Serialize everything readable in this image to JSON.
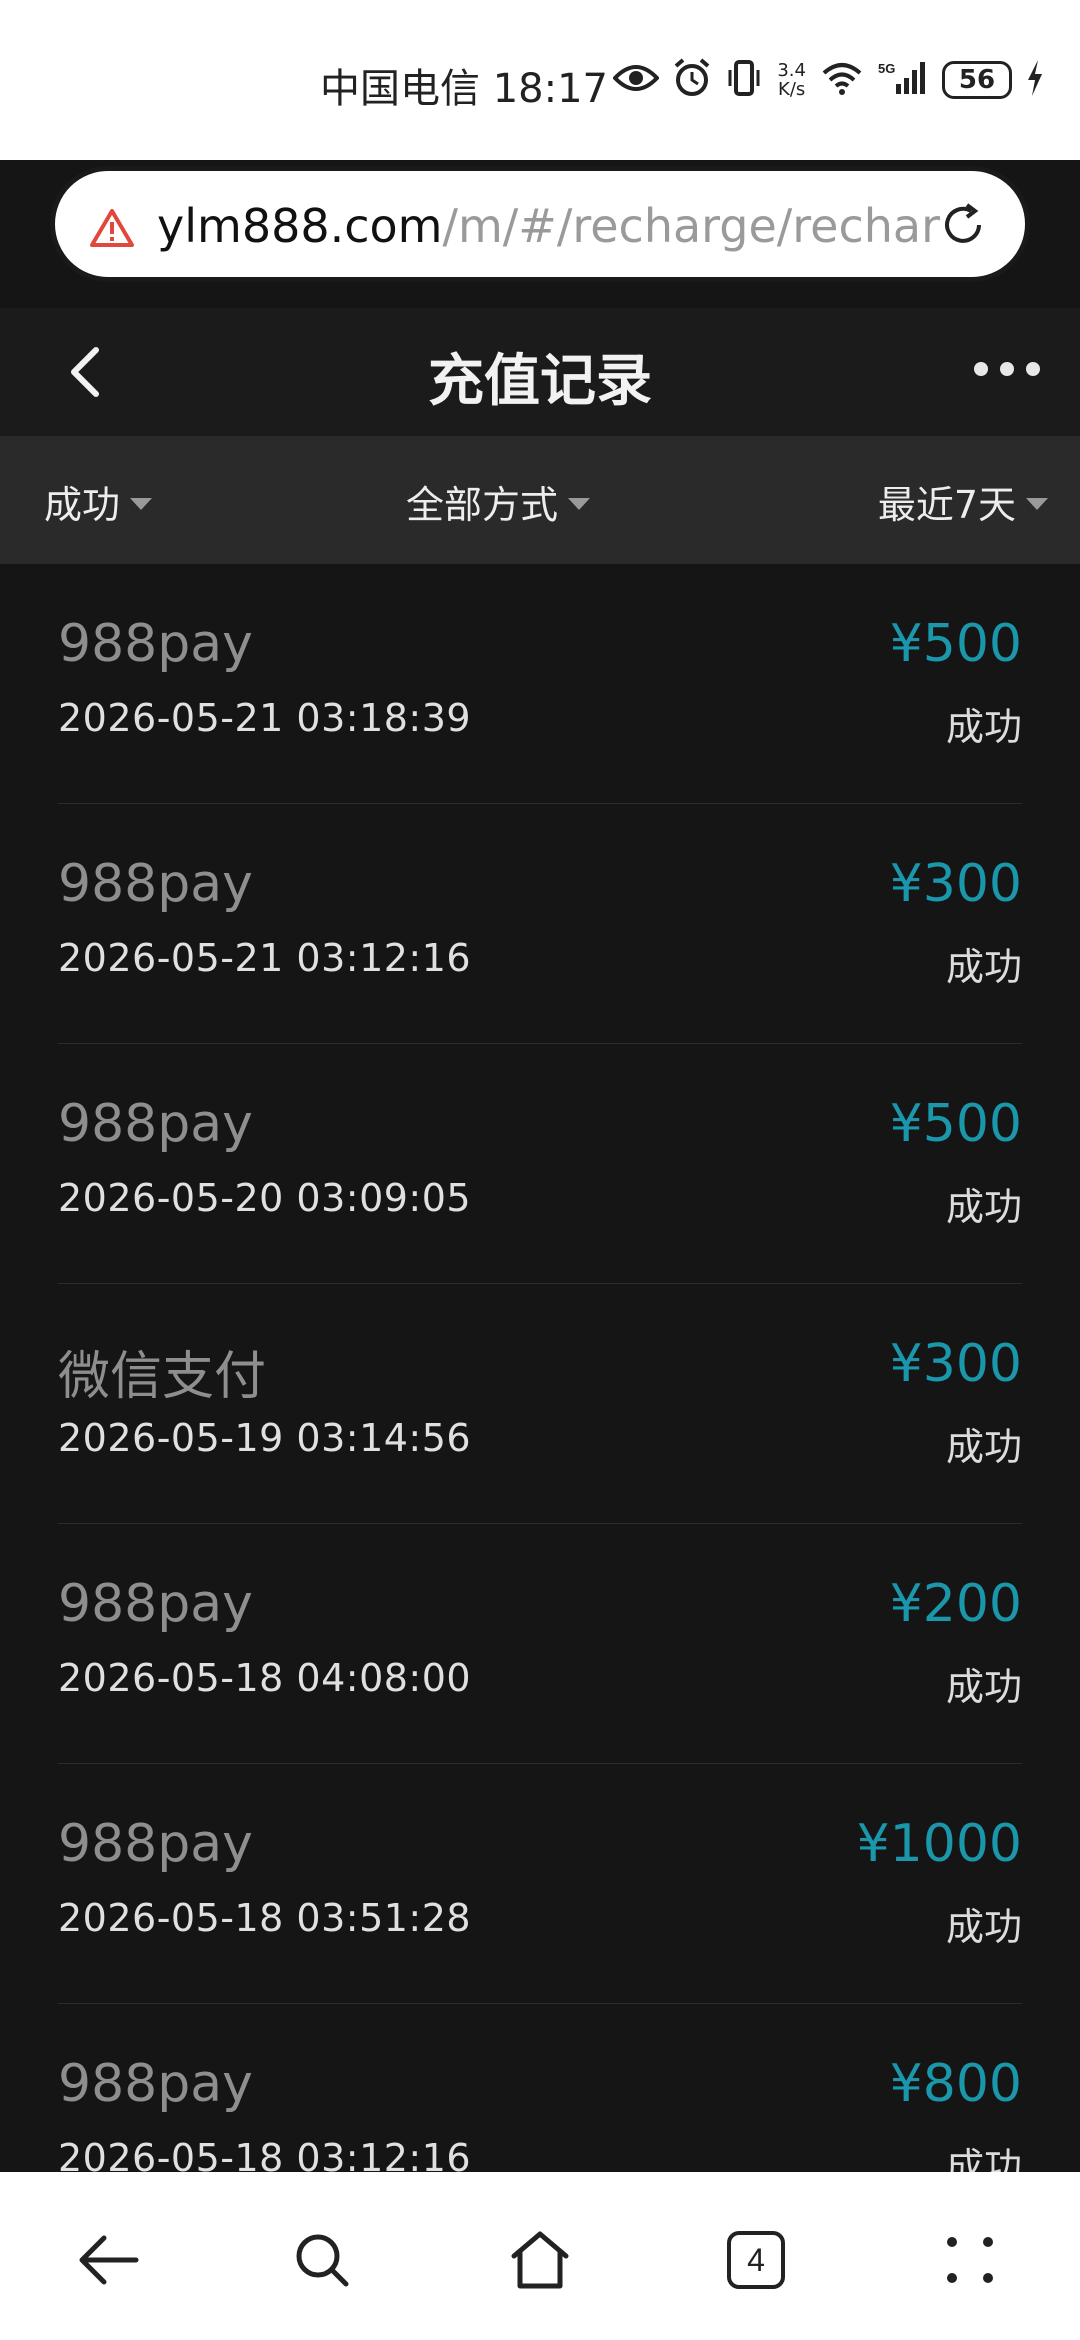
{
  "status_bar": {
    "carrier_time": "中国电信 18:17",
    "speed_value": "3.4",
    "speed_unit": "K/s",
    "network": "5G",
    "battery": "56"
  },
  "url_bar": {
    "host": "ylm888.com",
    "path": "/m/#/recharge/rechar"
  },
  "header": {
    "title": "充值记录"
  },
  "filters": {
    "status": "成功",
    "method": "全部方式",
    "time": "最近7天"
  },
  "records": [
    {
      "method": "988pay",
      "time": "2026-05-21 03:18:39",
      "amount": "¥500",
      "status": "成功"
    },
    {
      "method": "988pay",
      "time": "2026-05-21 03:12:16",
      "amount": "¥300",
      "status": "成功"
    },
    {
      "method": "988pay",
      "time": "2026-05-20 03:09:05",
      "amount": "¥500",
      "status": "成功"
    },
    {
      "method": "微信支付",
      "time": "2026-05-19 03:14:56",
      "amount": "¥300",
      "status": "成功"
    },
    {
      "method": "988pay",
      "time": "2026-05-18 04:08:00",
      "amount": "¥200",
      "status": "成功"
    },
    {
      "method": "988pay",
      "time": "2026-05-18 03:51:28",
      "amount": "¥1000",
      "status": "成功"
    },
    {
      "method": "988pay",
      "time": "2026-05-18 03:12:16",
      "amount": "¥800",
      "status": "成功"
    }
  ],
  "bottom_nav": {
    "tab_count": "4"
  },
  "colors": {
    "amount": "#1a97ab",
    "background": "#151515",
    "filter_bar": "#2a2a2a"
  }
}
